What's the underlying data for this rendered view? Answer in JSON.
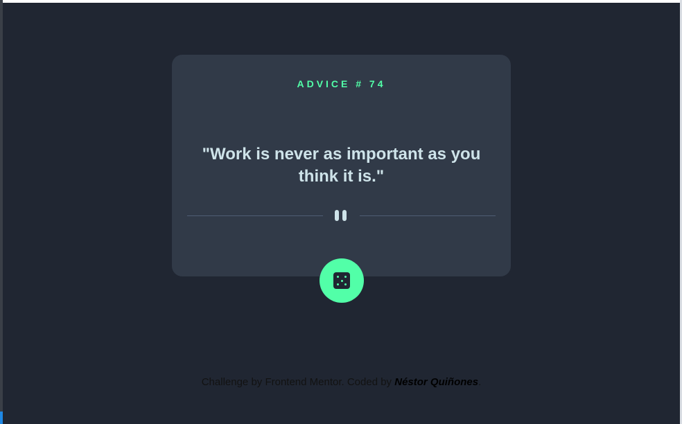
{
  "card": {
    "advice_label": "ADVICE # 74",
    "quote": "\"Work is never as important as you think it is.\""
  },
  "divider": {
    "icon": "pause-icon"
  },
  "button": {
    "icon": "dice-icon",
    "aria_label": "Generate new advice"
  },
  "footer": {
    "prefix": "Challenge by Frontend Mentor. Coded by ",
    "author": "Néstor Quiñones",
    "suffix": "."
  },
  "colors": {
    "background": "#202632",
    "card": "#313a48",
    "accent": "#52ffa8",
    "quote_text": "#cee3e9",
    "divider": "#4f5d74"
  }
}
